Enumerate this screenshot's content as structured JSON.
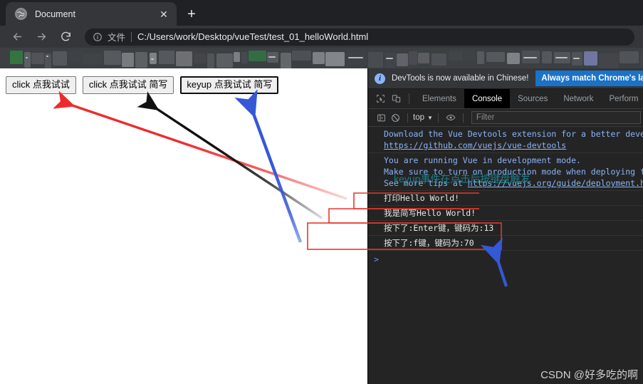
{
  "browser": {
    "tab": {
      "title": "Document",
      "favicon_icon": "globe-icon",
      "close_icon": "close-icon"
    },
    "newtab_icon": "plus-icon",
    "nav": {
      "back_icon": "arrow-left-icon",
      "forward_icon": "arrow-right-icon",
      "reload_icon": "reload-icon"
    },
    "omnibox": {
      "info_icon": "info-circle-icon",
      "scheme_label": "文件",
      "url": "C:/Users/work/Desktop/vueTest/test_01_helloWorld.html"
    }
  },
  "page": {
    "buttons": [
      {
        "label": "click 点我试试",
        "focused": false
      },
      {
        "label": "click 点我试试 简写",
        "focused": false
      },
      {
        "label": "keyup 点我试试 简写",
        "focused": true
      }
    ]
  },
  "devtools": {
    "banner": {
      "icon": "info-circle-icon",
      "text": "DevTools is now available in Chinese!",
      "button_label": "Always match Chrome's lang"
    },
    "tools": {
      "inspect_icon": "cursor-select-icon",
      "device_toolbar_icon": "device-toggle-icon"
    },
    "tabs": [
      {
        "label": "Elements",
        "active": false
      },
      {
        "label": "Console",
        "active": true
      },
      {
        "label": "Sources",
        "active": false
      },
      {
        "label": "Network",
        "active": false
      },
      {
        "label": "Perform",
        "active": false
      }
    ],
    "console_bar": {
      "sidebar_icon": "console-sidebar-icon",
      "clear_icon": "clear-console-icon",
      "context_label": "top",
      "context_caret_icon": "chevron-down-icon",
      "eye_icon": "eye-icon",
      "filter_placeholder": "Filter"
    },
    "console_logs": [
      {
        "kind": "vue-info",
        "lines": [
          "Download the Vue Devtools extension for a better develo",
          "https://github.com/vuejs/vue-devtools"
        ],
        "link_line": 1
      },
      {
        "kind": "vue-info",
        "lines": [
          "You are running Vue in development mode.",
          "Make sure to turn on production mode when deploying for",
          "See more tips at https://vuejs.org/guide/deployment.htm"
        ],
        "link_line": -1
      },
      {
        "kind": "plain",
        "lines": [
          "打印Hello World!"
        ],
        "link_line": -1
      },
      {
        "kind": "plain",
        "lines": [
          "我是简写Hello World!"
        ],
        "link_line": -1
      },
      {
        "kind": "plain",
        "lines": [
          "按下了:Enter键，键码为:13"
        ],
        "link_line": -1
      },
      {
        "kind": "plain",
        "lines": [
          "按下了:f键，键码为:70"
        ],
        "link_line": -1
      }
    ],
    "prompt_symbol": ">",
    "annotation_text": "keyup事件在点击后按键盘触发",
    "watermark": "CSDN @好多吃的啊"
  },
  "annotations": {
    "colors": {
      "red": "#ee2b2b",
      "black": "#111111",
      "blue": "#3458d6",
      "teal": "#1a7f87",
      "box_red": "#e8362c"
    },
    "arrows": [
      {
        "name": "red-arrow-to-button-1",
        "color": "#ee2b2b"
      },
      {
        "name": "black-arrow-to-button-2",
        "color": "#111111"
      },
      {
        "name": "blue-arrow-to-button-3",
        "color": "#3458d6"
      },
      {
        "name": "blue-arrow-to-keyup-logs",
        "color": "#3458d6"
      }
    ],
    "boxes": [
      {
        "name": "callout-box-log-1"
      },
      {
        "name": "callout-box-log-2"
      },
      {
        "name": "callout-box-keyup-logs"
      }
    ]
  }
}
